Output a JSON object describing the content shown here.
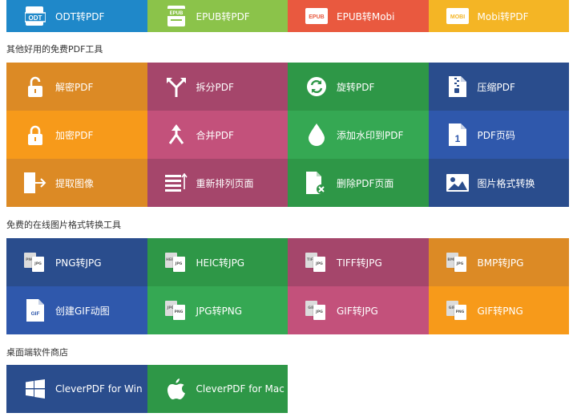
{
  "top_row": [
    {
      "label": "ODT转PDF",
      "badge": "ODT",
      "icon": "odt-file-icon",
      "color": "#1f88c9"
    },
    {
      "label": "EPUB转PDF",
      "badge": "EPUB",
      "icon": "epub-book-icon",
      "color": "#8bc34a"
    },
    {
      "label": "EPUB转Mobi",
      "badge": "EPUB",
      "icon": "epub-badge-icon",
      "color": "#e9593f"
    },
    {
      "label": "Mobi转PDF",
      "badge": "MOBI",
      "icon": "mobi-badge-icon",
      "color": "#f4b525"
    }
  ],
  "section_pdf_tools": {
    "title": "其他好用的免费PDF工具",
    "items": [
      {
        "label": "解密PDF",
        "icon": "unlock-icon"
      },
      {
        "label": "拆分PDF",
        "icon": "split-icon"
      },
      {
        "label": "旋转PDF",
        "icon": "rotate-icon"
      },
      {
        "label": "压缩PDF",
        "icon": "zip-icon"
      },
      {
        "label": "加密PDF",
        "icon": "lock-icon"
      },
      {
        "label": "合并PDF",
        "icon": "merge-icon"
      },
      {
        "label": "添加水印到PDF",
        "icon": "water-drop-icon"
      },
      {
        "label": "PDF页码",
        "icon": "page-number-icon",
        "badge": "1"
      },
      {
        "label": "提取图像",
        "icon": "extract-icon"
      },
      {
        "label": "重新排列页面",
        "icon": "reorder-icon"
      },
      {
        "label": "删除PDF页面",
        "icon": "delete-page-icon"
      },
      {
        "label": "图片格式转换",
        "icon": "image-icon"
      }
    ]
  },
  "section_image_tools": {
    "title": "免费的在线图片格式转换工具",
    "items": [
      {
        "label": "PNG转JPG",
        "icon": "png-jpg-icon",
        "from": "PNG",
        "to": "JPG"
      },
      {
        "label": "HEIC转JPG",
        "icon": "heic-jpg-icon",
        "from": "HEIC",
        "to": "JPG"
      },
      {
        "label": "TIFF转JPG",
        "icon": "tiff-jpg-icon",
        "from": "TIFF",
        "to": "JPG"
      },
      {
        "label": "BMP转JPG",
        "icon": "bmp-jpg-icon",
        "from": "BMP",
        "to": "JPG"
      },
      {
        "label": "创建GIF动图",
        "icon": "gif-file-icon",
        "badge": "GIF"
      },
      {
        "label": "JPG转PNG",
        "icon": "jpg-png-icon",
        "from": "JPG",
        "to": "PNG"
      },
      {
        "label": "GIF转JPG",
        "icon": "gif-jpg-icon",
        "from": "GIF",
        "to": "JPG"
      },
      {
        "label": "GIF转PNG",
        "icon": "gif-png-icon",
        "from": "GIF",
        "to": "PNG"
      }
    ]
  },
  "section_desktop": {
    "title": "桌面端软件商店",
    "items": [
      {
        "label": "CleverPDF for Win",
        "icon": "windows-icon"
      },
      {
        "label": "CleverPDF for Mac",
        "icon": "apple-icon"
      }
    ]
  }
}
